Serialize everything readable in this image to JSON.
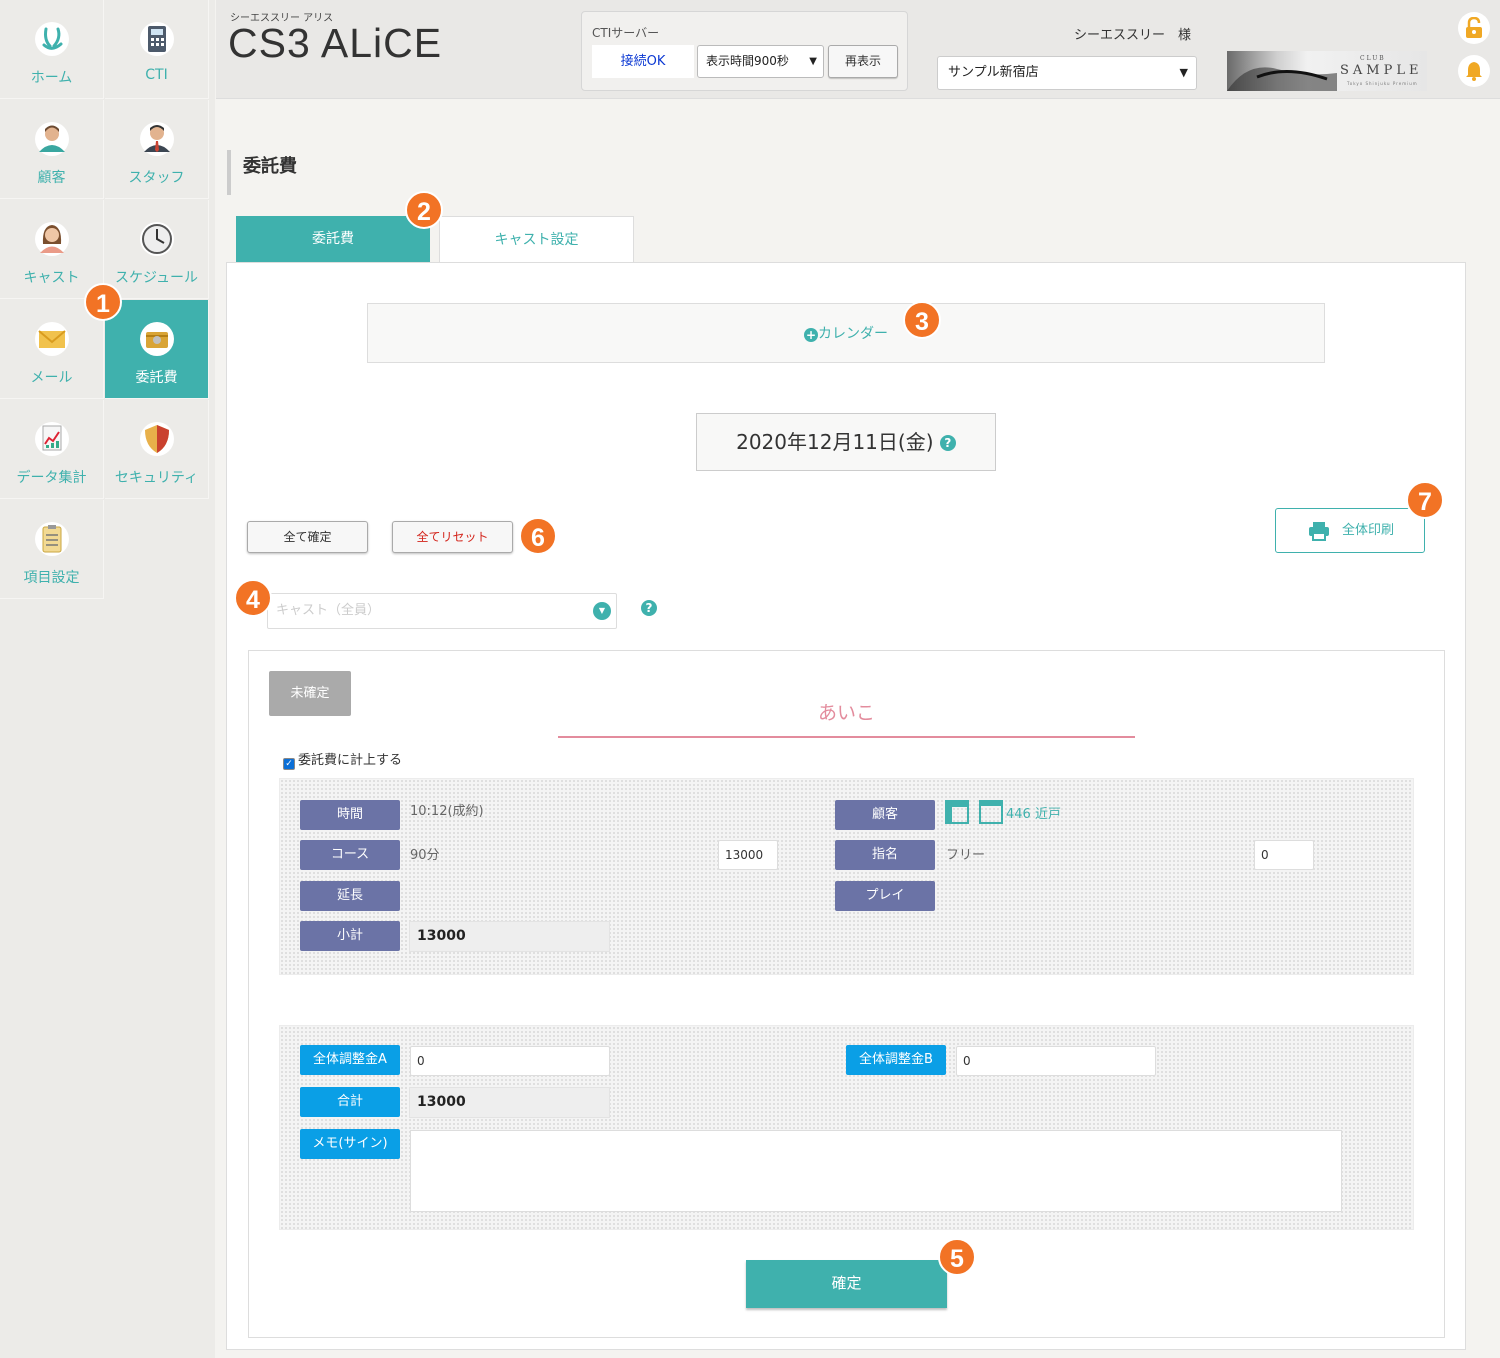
{
  "sidebar": {
    "items": [
      {
        "label": "ホーム",
        "icon": "home-icon"
      },
      {
        "label": "CTI",
        "icon": "phone-icon"
      },
      {
        "label": "顧客",
        "icon": "customer-icon"
      },
      {
        "label": "スタッフ",
        "icon": "staff-icon"
      },
      {
        "label": "キャスト",
        "icon": "cast-icon"
      },
      {
        "label": "スケジュール",
        "icon": "clock-icon"
      },
      {
        "label": "メール",
        "icon": "mail-icon"
      },
      {
        "label": "委託費",
        "icon": "wallet-icon",
        "active": true
      },
      {
        "label": "データ集計",
        "icon": "chart-icon"
      },
      {
        "label": "セキュリティ",
        "icon": "shield-icon"
      },
      {
        "label": "項目設定",
        "icon": "clipboard-icon"
      }
    ]
  },
  "header": {
    "brand_sub": "シーエススリー アリス",
    "brand": "CS3 ALiCE",
    "cti_title": "CTIサーバー",
    "cti_status": "接続OK",
    "cti_interval": "表示時間900秒",
    "refresh_label": "再表示",
    "user_name": "シーエススリー　様",
    "store": "サンプル新宿店",
    "logo_club": "CLUB",
    "logo_text": "SAMPLE",
    "logo_small": "Tokyo Shinjuku Premium"
  },
  "page": {
    "title": "委託費",
    "tabs": [
      "委託費",
      "キャスト設定"
    ],
    "calendar_label": "カレンダー",
    "date": "2020年12月11日(金)",
    "help": "?",
    "confirm_all": "全て確定",
    "reset_all": "全てリセット",
    "print_all": "全体印刷",
    "cast_placeholder": "キャスト（全員）"
  },
  "card": {
    "status": "未確定",
    "cast_name": "あいこ",
    "include_label": "委託費に計上する",
    "labels": {
      "time": "時間",
      "course": "コース",
      "extension": "延長",
      "subtotal": "小計",
      "customer": "顧客",
      "nomination": "指名",
      "play": "プレイ",
      "adjust_a": "全体調整金A",
      "adjust_b": "全体調整金B",
      "total": "合計",
      "memo": "メモ(サイン)"
    },
    "values": {
      "time": "10:12(成約)",
      "course_name": "90分",
      "course_price": "13000",
      "subtotal": "13000",
      "customer": "446 近戸",
      "nomination_name": "フリー",
      "nomination_price": "0",
      "adjust_a": "0",
      "adjust_b": "0",
      "total": "13000"
    },
    "confirm_label": "確定"
  },
  "badges": [
    "1",
    "2",
    "3",
    "4",
    "5",
    "6",
    "7"
  ],
  "colors": {
    "accent": "#3fb1ad",
    "badge": "#f27325",
    "label_purple": "#6b73a6",
    "label_blue": "#0a9fe6",
    "cast_pink": "#e38c9d"
  }
}
